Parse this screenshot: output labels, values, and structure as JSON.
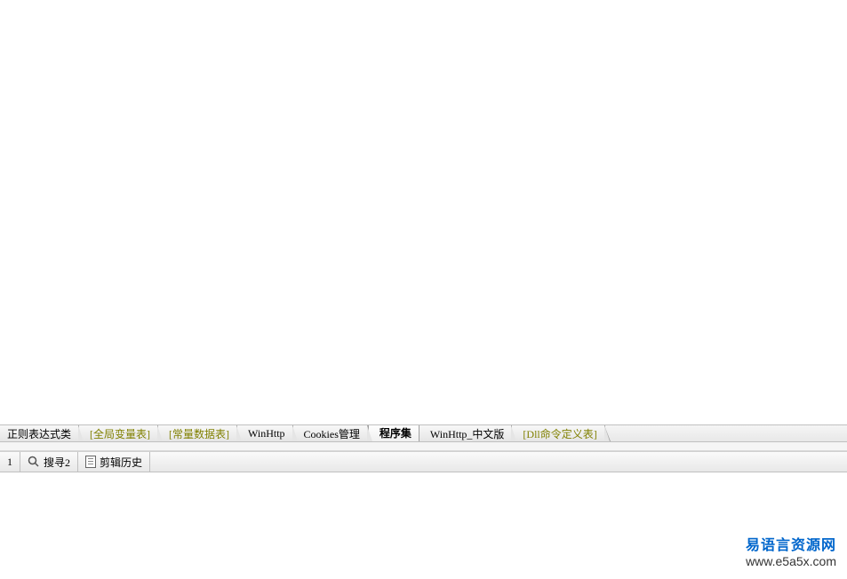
{
  "tabs": {
    "partial_first": "正则表达式类",
    "global_vars": "[全局变量表]",
    "const_data": "[常量数据表]",
    "winhttp": "WinHttp",
    "cookies": "Cookies管理",
    "programset": "程序集",
    "winhttp_cn": "WinHttp_中文版",
    "dll_cmd": "[Dll命令定义表]"
  },
  "bottom_tabs": {
    "item1_suffix": "1",
    "search2": "搜寻2",
    "edit_history": "剪辑历史"
  },
  "watermark": {
    "title": "易语言资源网",
    "url": "www.e5a5x.com"
  }
}
